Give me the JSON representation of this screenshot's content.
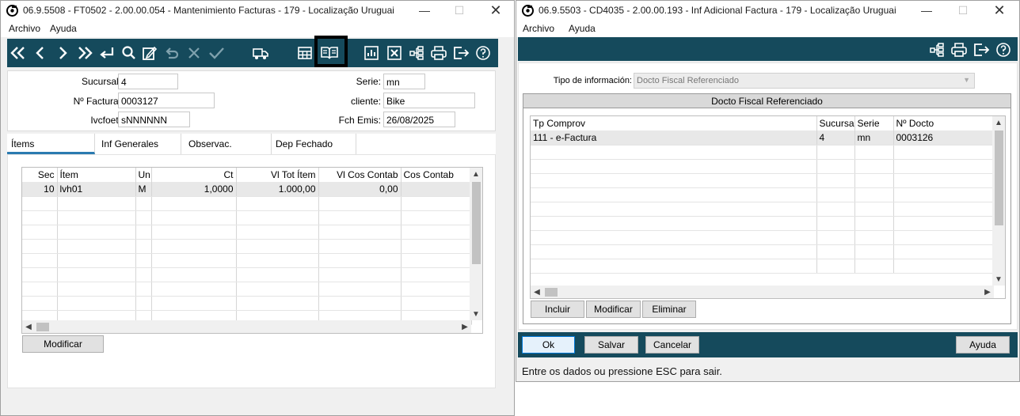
{
  "win1": {
    "title": "06.9.5508 - FT0502 - 2.00.00.054 - Mantenimiento Facturas - 179 - Localização Uruguai",
    "menu": [
      "Archivo",
      "Ayuda"
    ],
    "fields": {
      "sucursal_label": "Sucursal:",
      "sucursal_value": "4",
      "factura_label": "Nº Factura:",
      "factura_value": "0003127",
      "ivcfoet_label": "Ivcfoet:",
      "ivcfoet_value": "sNNNNNN",
      "serie_label": "Serie:",
      "serie_value": "mn",
      "cliente_label": "cliente:",
      "cliente_value": "Bike",
      "fch_label": "Fch Emis:",
      "fch_value": "26/08/2025"
    },
    "tabs": [
      "Ítems",
      "Inf Generales",
      "Observac.",
      "Dep Fechado"
    ],
    "items_table": {
      "headers": [
        "Sec",
        "Ítem",
        "Un",
        "Ct",
        "Vl Tot Ítem",
        "Vl Cos Contab",
        "Cos Contab"
      ],
      "rows": [
        [
          "10",
          "lvh01",
          "M",
          "1,0000",
          "1.000,00",
          "0,00",
          ""
        ]
      ]
    },
    "modify_button": "Modificar"
  },
  "win2": {
    "title": "06.9.5503 - CD4035 - 2.00.00.193 - Inf Adicional Factura - 179 - Localização Uruguai",
    "menu": [
      "Archivo",
      "Ayuda"
    ],
    "tipo_label": "Tipo de información:",
    "tipo_value": "Docto Fiscal Referenciado",
    "group_title": "Docto Fiscal Referenciado",
    "ref_table": {
      "headers": [
        "Tp Comprov",
        "Sucursal",
        "Serie",
        "Nº Docto"
      ],
      "rows": [
        [
          "111 - e-Factura",
          "4",
          "mn",
          "0003126"
        ]
      ]
    },
    "buttons": {
      "incluir": "Incluir",
      "modificar": "Modificar",
      "eliminar": "Eliminar"
    },
    "footer": {
      "ok": "Ok",
      "salvar": "Salvar",
      "cancelar": "Cancelar",
      "ayuda": "Ayuda"
    },
    "status": "Entre os dados ou pressione ESC para sair."
  },
  "colors": {
    "toolbar_bg": "#154a5c",
    "active_tab": "#2a7ab0",
    "highlight_box": "#000000"
  },
  "icons": {
    "win1_toolbar": [
      "first-icon",
      "prev-icon",
      "next-icon",
      "last-icon",
      "return-icon",
      "search-icon",
      "edit-icon",
      "undo-icon",
      "cancel-icon",
      "confirm-icon",
      "truck-icon",
      "calculator-icon",
      "book-icon",
      "chart-icon",
      "close-box-icon",
      "hierarchy-icon",
      "print-icon",
      "exit-icon",
      "help-icon"
    ],
    "win2_toolbar": [
      "hierarchy-icon",
      "print-icon",
      "exit-icon",
      "help-icon"
    ]
  }
}
